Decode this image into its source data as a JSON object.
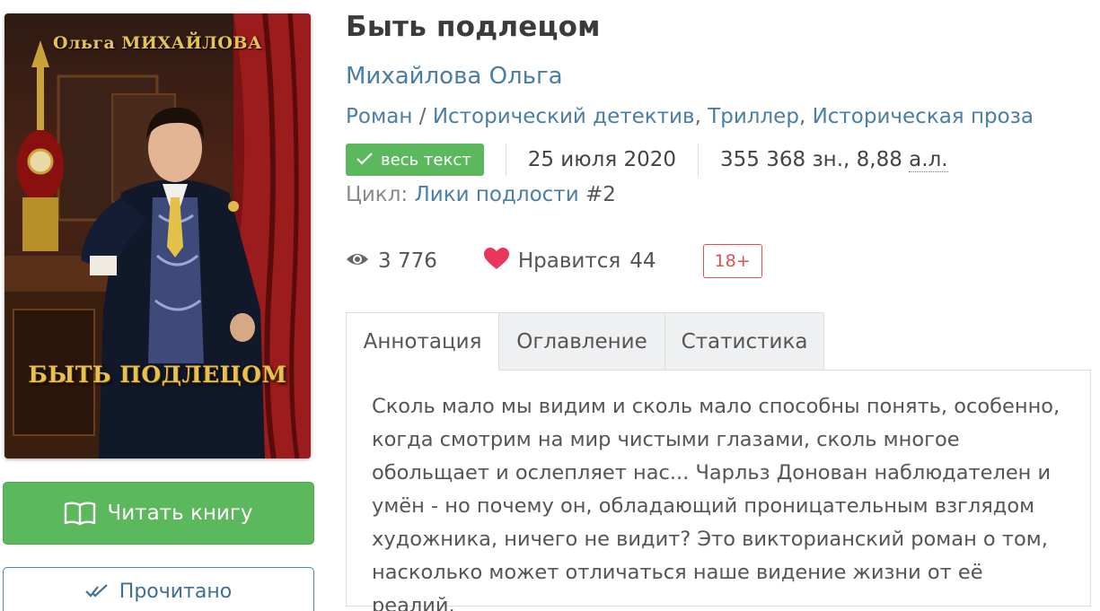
{
  "cover": {
    "author_text": "Ольга МИХАЙЛОВА",
    "title_text": "БЫТЬ ПОДЛЕЦОМ"
  },
  "actions": {
    "read_label": "Читать книгу",
    "read_icon": "book-open-icon",
    "done_label": "Прочитано",
    "done_icon": "double-check-icon"
  },
  "book": {
    "title": "Быть подлецом",
    "author": "Михайлова Ольга",
    "genres": [
      "Роман",
      "Исторический детектив",
      "Триллер",
      "Историческая проза"
    ],
    "genre_sep_1": " / ",
    "genre_sep": ", ",
    "full_text_badge": "весь текст",
    "date": "25 июля 2020",
    "size_chars": "355 368 зн., 8,88 ",
    "size_abbr": "а.л.",
    "cycle_label": "Цикл: ",
    "cycle_name": "Лики подлости",
    "cycle_num": " #2"
  },
  "stats": {
    "views": "3 776",
    "likes_label": "Нравится",
    "likes_count": "44",
    "age_rating": "18+"
  },
  "tabs": [
    {
      "label": "Аннотация",
      "active": true
    },
    {
      "label": "Оглавление",
      "active": false
    },
    {
      "label": "Статистика",
      "active": false
    }
  ],
  "annotation": "Сколь мало мы видим и сколь мало способны понять, особенно, когда смотрим на мир чистыми глазами, сколь многое обольщает и ослепляет нас... Чарльз Донован наблюдателен и умён - но почему он, обладающий проницательным взглядом художника, ничего не видит? Это викторианский роман о том, насколько может отличаться наше видение жизни от её реалий.",
  "colors": {
    "accent_green": "#5cb85c",
    "link_blue": "#4a7ea4",
    "age_red": "#d9534f",
    "heart": "#e8365d"
  }
}
